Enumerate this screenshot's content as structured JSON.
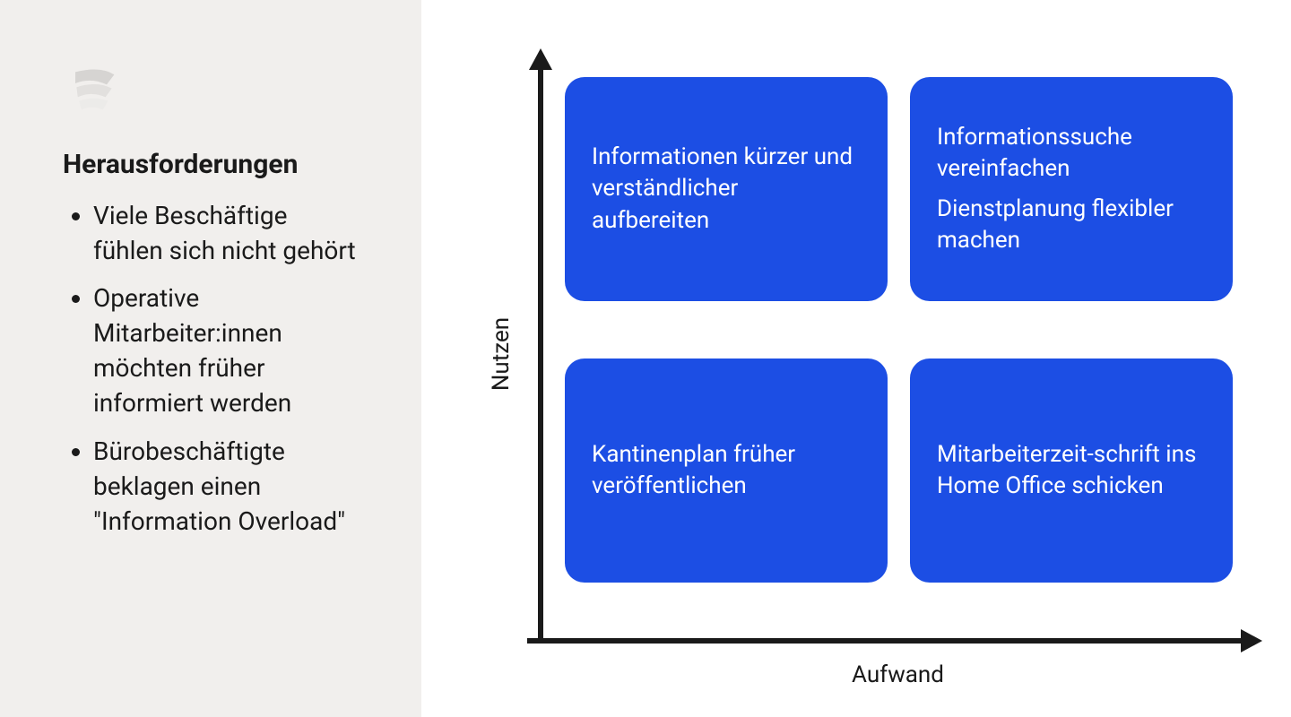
{
  "sidebar": {
    "title": "Herausforderungen",
    "items": [
      "Viele Beschäftige fühlen sich nicht gehört",
      "Operative Mitarbeiter:innen möchten früher informiert werden",
      "Bürobeschäftigte beklagen einen \"Information Overload\""
    ]
  },
  "chart_data": {
    "type": "quadrant",
    "xlabel": "Aufwand",
    "ylabel": "Nutzen",
    "quadrants": {
      "top_left": {
        "cell": "low_effort_high_benefit",
        "items": [
          "Informationen kürzer und verständlicher aufbereiten"
        ]
      },
      "top_right": {
        "cell": "high_effort_high_benefit",
        "items": [
          "Informationssuche vereinfachen",
          "Dienstplanung flexibler machen"
        ]
      },
      "bottom_left": {
        "cell": "low_effort_low_benefit",
        "items": [
          "Kantinenplan früher veröffentlichen"
        ]
      },
      "bottom_right": {
        "cell": "high_effort_low_benefit",
        "items": [
          "Mitarbeiterzeit-schrift ins Home Office schicken"
        ]
      }
    },
    "colors": {
      "quadrant_fill": "#1c4ee4",
      "quadrant_text": "#ffffff",
      "axis": "#1a1a1a",
      "sidebar_bg": "#f1efed"
    }
  }
}
